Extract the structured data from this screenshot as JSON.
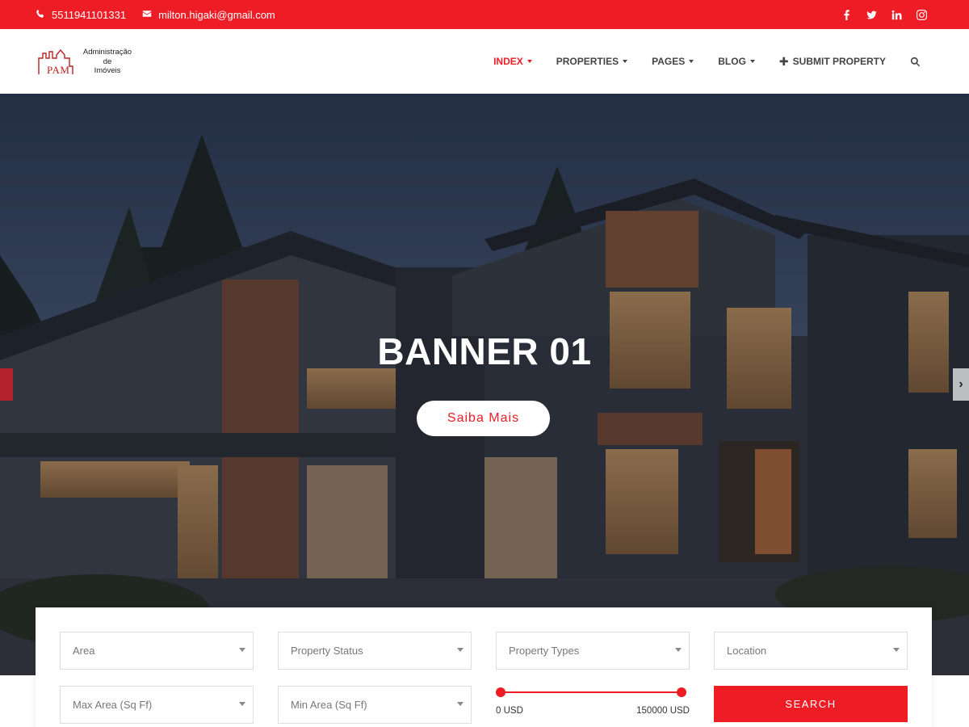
{
  "topbar": {
    "phone": "5511941101331",
    "email": "milton.higaki@gmail.com",
    "social": [
      "facebook-icon",
      "twitter-icon",
      "linkedin-icon",
      "instagram-icon"
    ]
  },
  "logo": {
    "mark": "PAM",
    "line1": "Administração",
    "line2": "de",
    "line3": "Imóveis"
  },
  "nav": {
    "items": [
      {
        "label": "INDEX",
        "dropdown": true,
        "active": true
      },
      {
        "label": "PROPERTIES",
        "dropdown": true
      },
      {
        "label": "PAGES",
        "dropdown": true
      },
      {
        "label": "BLOG",
        "dropdown": true
      }
    ],
    "submit": "SUBMIT PROPERTY",
    "search_icon": "search-icon"
  },
  "hero": {
    "title": "BANNER 01",
    "cta": "Saiba Mais"
  },
  "search": {
    "row1": [
      "Area",
      "Property Status",
      "Property Types",
      "Location"
    ],
    "row2": [
      "Max Area (Sq Ff)",
      "Min Area (Sq Ff)"
    ],
    "range_min": "0 USD",
    "range_max": "150000 USD",
    "button": "SEARCH"
  },
  "colors": {
    "accent": "#ee1c25",
    "text": "#444444"
  }
}
